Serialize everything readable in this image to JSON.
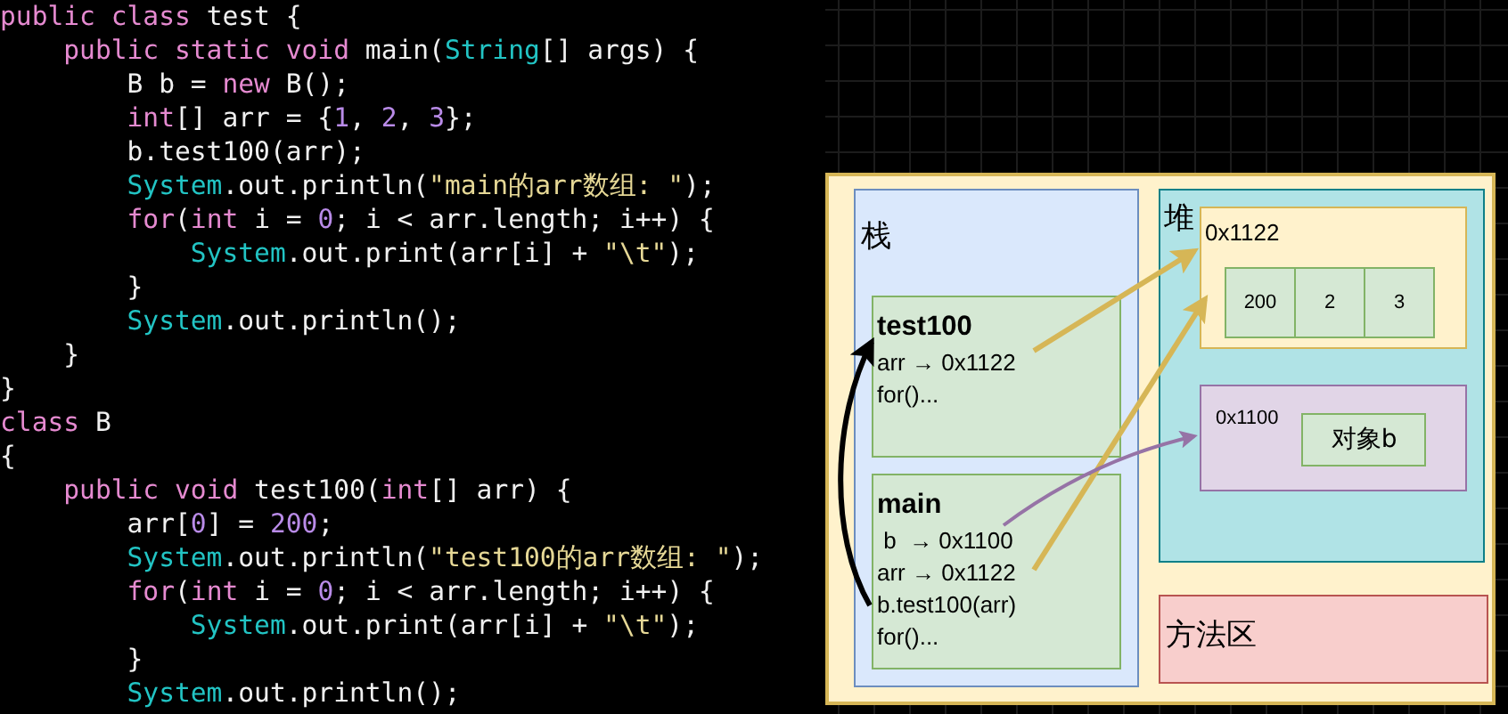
{
  "code": {
    "lines": [
      [
        {
          "kind": "keyword",
          "text": "public class "
        },
        {
          "kind": "plain",
          "text": "test {"
        }
      ],
      [
        {
          "kind": "keyword",
          "text": "    public static void "
        },
        {
          "kind": "plain",
          "text": "main("
        },
        {
          "kind": "type",
          "text": "String"
        },
        {
          "kind": "plain",
          "text": "[] args) {"
        }
      ],
      [
        {
          "kind": "plain",
          "text": "        B b = "
        },
        {
          "kind": "keyword",
          "text": "new "
        },
        {
          "kind": "plain",
          "text": "B();"
        }
      ],
      [
        {
          "kind": "keyword",
          "text": "        int"
        },
        {
          "kind": "plain",
          "text": "[] arr = {"
        },
        {
          "kind": "number",
          "text": "1"
        },
        {
          "kind": "plain",
          "text": ", "
        },
        {
          "kind": "number",
          "text": "2"
        },
        {
          "kind": "plain",
          "text": ", "
        },
        {
          "kind": "number",
          "text": "3"
        },
        {
          "kind": "plain",
          "text": "};"
        }
      ],
      [
        {
          "kind": "plain",
          "text": "        b.test100(arr);"
        }
      ],
      [
        {
          "kind": "type",
          "text": "        System"
        },
        {
          "kind": "plain",
          "text": ".out.println("
        },
        {
          "kind": "string",
          "text": "\"main的arr数组: \""
        },
        {
          "kind": "plain",
          "text": ");"
        }
      ],
      [
        {
          "kind": "keyword",
          "text": "        for"
        },
        {
          "kind": "plain",
          "text": "("
        },
        {
          "kind": "keyword",
          "text": "int"
        },
        {
          "kind": "plain",
          "text": " i = "
        },
        {
          "kind": "number",
          "text": "0"
        },
        {
          "kind": "plain",
          "text": "; i < arr.length; i++) {"
        }
      ],
      [
        {
          "kind": "type",
          "text": "            System"
        },
        {
          "kind": "plain",
          "text": ".out.print(arr[i] + "
        },
        {
          "kind": "string",
          "text": "\"\\t\""
        },
        {
          "kind": "plain",
          "text": ");"
        }
      ],
      [
        {
          "kind": "plain",
          "text": "        }"
        }
      ],
      [
        {
          "kind": "type",
          "text": "        System"
        },
        {
          "kind": "plain",
          "text": ".out.println();"
        }
      ],
      [
        {
          "kind": "plain",
          "text": "    }"
        }
      ],
      [
        {
          "kind": "plain",
          "text": "}"
        }
      ],
      [
        {
          "kind": "keyword",
          "text": "class "
        },
        {
          "kind": "plain",
          "text": "B"
        }
      ],
      [
        {
          "kind": "plain",
          "text": "{"
        }
      ],
      [
        {
          "kind": "keyword",
          "text": "    public void "
        },
        {
          "kind": "plain",
          "text": "test100("
        },
        {
          "kind": "keyword",
          "text": "int"
        },
        {
          "kind": "plain",
          "text": "[] arr) {"
        }
      ],
      [
        {
          "kind": "plain",
          "text": "        arr["
        },
        {
          "kind": "number",
          "text": "0"
        },
        {
          "kind": "plain",
          "text": "] = "
        },
        {
          "kind": "number",
          "text": "200"
        },
        {
          "kind": "plain",
          "text": ";"
        }
      ],
      [
        {
          "kind": "type",
          "text": "        System"
        },
        {
          "kind": "plain",
          "text": ".out.println("
        },
        {
          "kind": "string",
          "text": "\"test100的arr数组: \""
        },
        {
          "kind": "plain",
          "text": ");"
        }
      ],
      [
        {
          "kind": "keyword",
          "text": "        for"
        },
        {
          "kind": "plain",
          "text": "("
        },
        {
          "kind": "keyword",
          "text": "int"
        },
        {
          "kind": "plain",
          "text": " i = "
        },
        {
          "kind": "number",
          "text": "0"
        },
        {
          "kind": "plain",
          "text": "; i < arr.length; i++) {"
        }
      ],
      [
        {
          "kind": "type",
          "text": "            System"
        },
        {
          "kind": "plain",
          "text": ".out.print(arr[i] + "
        },
        {
          "kind": "string",
          "text": "\"\\t\""
        },
        {
          "kind": "plain",
          "text": ");"
        }
      ],
      [
        {
          "kind": "plain",
          "text": "        }"
        }
      ],
      [
        {
          "kind": "type",
          "text": "        System"
        },
        {
          "kind": "plain",
          "text": ".out.println();"
        }
      ]
    ]
  },
  "diagram": {
    "stack": {
      "label": "栈",
      "frames": [
        {
          "title": "test100",
          "lines": [
            "arr → 0x1122",
            "for()..."
          ]
        },
        {
          "title": "main",
          "lines": [
            " b  → 0x1100",
            "arr → 0x1122",
            "b.test100(arr)",
            "for()..."
          ]
        }
      ]
    },
    "heap": {
      "label": "堆",
      "array": {
        "address": "0x1122",
        "cells": [
          "200",
          "2",
          "3"
        ]
      },
      "object": {
        "address": "0x1100",
        "label": "对象b"
      }
    },
    "method_area": {
      "label": "方法区"
    }
  }
}
